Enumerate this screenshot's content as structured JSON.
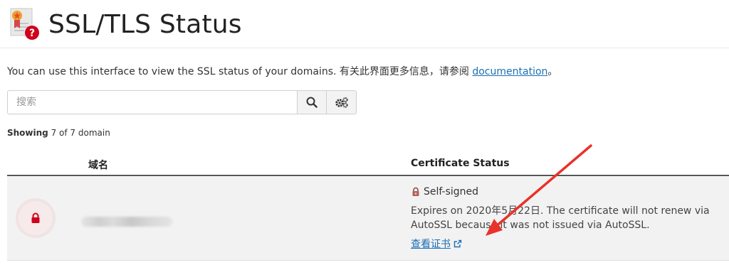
{
  "header": {
    "title": "SSL/TLS Status"
  },
  "intro": {
    "text": "You can use this interface to view the SSL status of your domains. 有关此界面更多信息，请参阅 ",
    "link_label": "documentation",
    "suffix": "。"
  },
  "search": {
    "placeholder": "搜索",
    "value": ""
  },
  "showing": {
    "label": "Showing",
    "count_text": "7 of 7 domain"
  },
  "table": {
    "columns": [
      "域名",
      "Certificate Status"
    ],
    "rows": [
      {
        "domain": "",
        "status": "Self-signed",
        "expires": "Expires on 2020年5月22日. The certificate will not renew via AutoSSL because it was not issued via AutoSSL.",
        "view_label": "查看证书"
      }
    ]
  },
  "colors": {
    "link": "#1a6fb5",
    "lock": "#d0021b",
    "arrow": "#e8322a"
  },
  "icons": {
    "page": "certificate-warning-icon",
    "search": "search-icon",
    "settings": "gears-icon",
    "row_status": "lock-icon",
    "self_signed": "self-signed-icon",
    "external": "external-link-icon"
  }
}
